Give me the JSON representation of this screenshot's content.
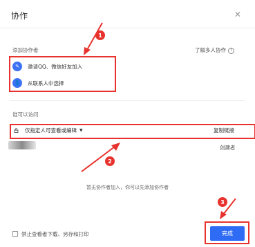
{
  "dialog": {
    "title": "协作",
    "close_icon": "close-icon"
  },
  "add_section": {
    "label": "添加协作者",
    "learn_more": "了解多人协作",
    "options": [
      {
        "icon": "link-icon",
        "label": "邀请QQ、微信好友加入"
      },
      {
        "icon": "contacts-icon",
        "label": "从联系人中选择"
      }
    ]
  },
  "access_section": {
    "label": "谁可以访问",
    "permission": "仅指定人可查看或编辑",
    "copy_link": "复制链接"
  },
  "owner": {
    "role": "创建者"
  },
  "empty_message": "暂无协作者加入，你可以先添加协作者",
  "footer": {
    "checkbox_label": "禁止查看者下载、另存和打印",
    "done_label": "完成"
  },
  "annotations": {
    "badge1": "1",
    "badge2": "2",
    "badge3": "3",
    "color": "#e8322d"
  },
  "colors": {
    "accent": "#2f6cf5",
    "annotation_red": "#e8322d"
  }
}
